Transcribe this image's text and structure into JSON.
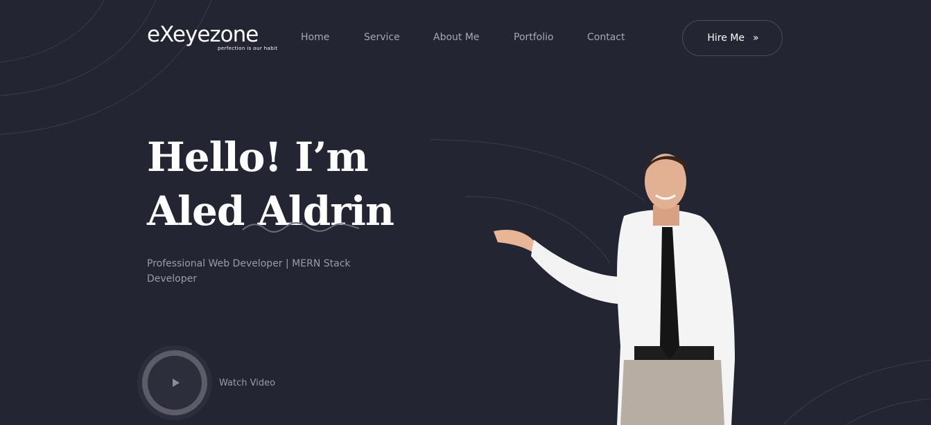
{
  "logo": {
    "wordmark": "eXeyezone",
    "tagline": "perfection is our habit"
  },
  "nav": {
    "items": [
      {
        "label": "Home"
      },
      {
        "label": "Service"
      },
      {
        "label": "About Me"
      },
      {
        "label": "Portfolio"
      },
      {
        "label": "Contact"
      }
    ]
  },
  "cta": {
    "label": "Hire Me",
    "arrow": "»"
  },
  "hero": {
    "line1": "Hello! I’m",
    "line2": "Aled Aldrin",
    "subtitle": "Professional Web Developer | MERN Stack Developer"
  },
  "video": {
    "label": "Watch Video",
    "icon": "play-icon"
  },
  "colors": {
    "background": "#232533",
    "text": "#ffffff",
    "muted": "#9a9ca8",
    "button_border": "#4a4c5a"
  }
}
